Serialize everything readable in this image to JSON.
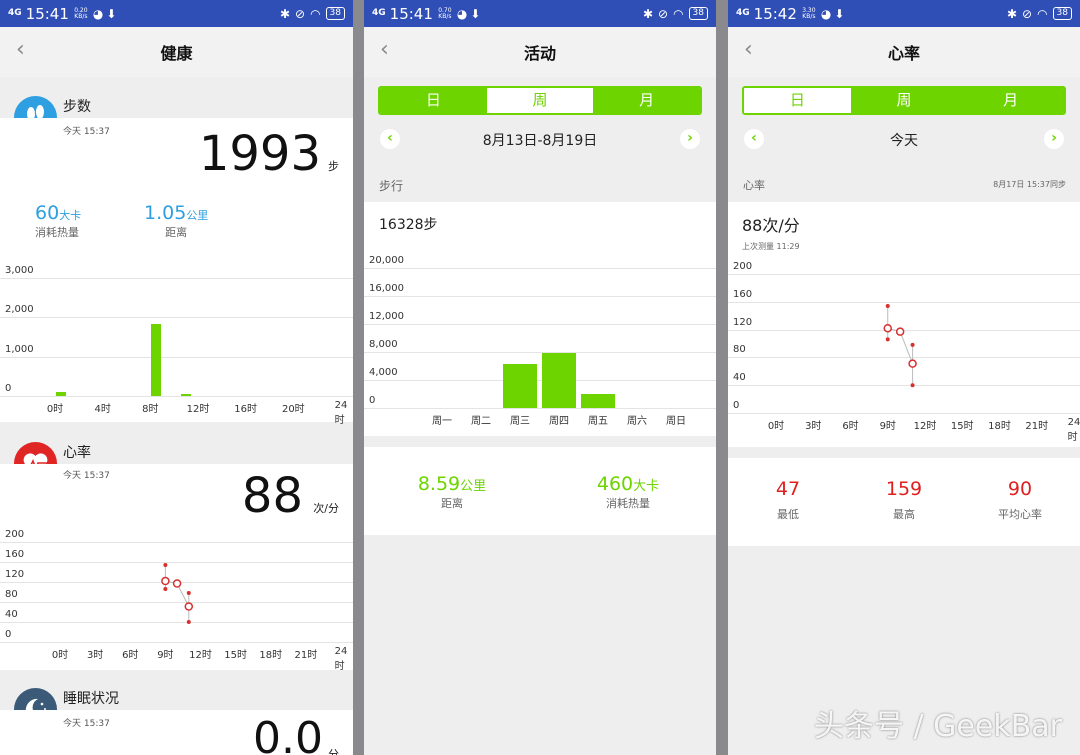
{
  "status_bars": [
    {
      "network": "4G",
      "time": "15:41",
      "speed": "0.20 KB/s",
      "battery": "38"
    },
    {
      "network": "4G",
      "time": "15:41",
      "speed": "0.70 KB/s",
      "battery": "38"
    },
    {
      "network": "4G",
      "time": "15:42",
      "speed": "3.30 KB/s",
      "battery": "38"
    }
  ],
  "screen1": {
    "back": "‹",
    "title": "健康",
    "steps": {
      "label": "步数",
      "time": "今天 15:37",
      "value": "1993",
      "unit": "步",
      "calories_value": "60",
      "calories_unit": "大卡",
      "calories_label": "消耗热量",
      "distance_value": "1.05",
      "distance_unit": "公里",
      "distance_label": "距离"
    },
    "heart": {
      "label": "心率",
      "time": "今天 15:37",
      "value": "88",
      "unit": "次/分"
    },
    "sleep": {
      "label": "睡眠状况",
      "time": "今天 15:37",
      "value": "0.0",
      "unit": "分"
    }
  },
  "screen2": {
    "back": "‹",
    "title": "活动",
    "tabs": [
      "日",
      "周",
      "月"
    ],
    "date_range": "8月13日-8月19日",
    "section": "步行",
    "total": "16328步",
    "distance_value": "8.59",
    "distance_unit": "公里",
    "distance_label": "距离",
    "calories_value": "460",
    "calories_unit": "大卡",
    "calories_label": "消耗热量"
  },
  "screen3": {
    "back": "‹",
    "title": "心率",
    "tabs": [
      "日",
      "周",
      "月"
    ],
    "day": "今天",
    "section": "心率",
    "sync": "8月17日 15:37同步",
    "value": "88次/分",
    "last": "上次测量 11:29",
    "min_value": "47",
    "min_label": "最低",
    "max_value": "159",
    "max_label": "最高",
    "avg_value": "90",
    "avg_label": "平均心率"
  },
  "watermark": "头条号 / GeekBar",
  "chart_data": [
    {
      "type": "bar",
      "title": "步数",
      "x_ticks": [
        "0时",
        "4时",
        "8时",
        "12时",
        "16时",
        "20时",
        "24时"
      ],
      "y_ticks": [
        "3,000",
        "2,000",
        "1,000",
        "0"
      ],
      "ylim": [
        0,
        3000
      ],
      "x_range": [
        0,
        24
      ],
      "bars": [
        {
          "hour": 0.5,
          "value": 90
        },
        {
          "hour": 8.5,
          "value": 1830
        },
        {
          "hour": 11,
          "value": 40
        }
      ],
      "color": "#6dd400"
    },
    {
      "type": "bar",
      "title": "步行",
      "categories": [
        "周一",
        "周二",
        "周三",
        "周四",
        "周五",
        "周六",
        "周日"
      ],
      "values": [
        0,
        0,
        6300,
        7900,
        1950,
        0,
        0
      ],
      "y_ticks": [
        "20,000",
        "16,000",
        "12,000",
        "8,000",
        "4,000",
        "0"
      ],
      "ylim": [
        0,
        20000
      ],
      "color": "#6dd400"
    },
    {
      "type": "scatter",
      "title": "心率",
      "x_ticks": [
        "0时",
        "3时",
        "6时",
        "9时",
        "12时",
        "15时",
        "18时",
        "21时",
        "24时"
      ],
      "y_ticks": [
        "200",
        "160",
        "120",
        "80",
        "40",
        "0"
      ],
      "ylim": [
        0,
        200
      ],
      "x_range": [
        0,
        24
      ],
      "points": [
        {
          "hour": 9,
          "value": 122,
          "high": 154,
          "low": 106
        },
        {
          "hour": 10,
          "value": 117
        },
        {
          "hour": 11,
          "value": 71,
          "high": 98,
          "low": 40
        }
      ],
      "color": "#d63030"
    }
  ]
}
